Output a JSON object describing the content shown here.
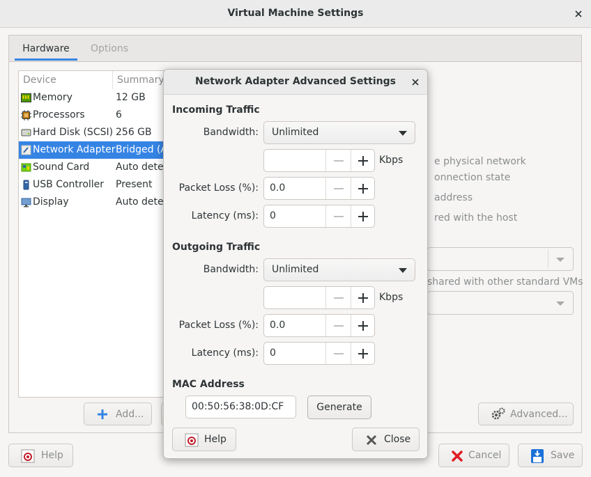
{
  "main": {
    "title": "Virtual Machine Settings",
    "tabs": [
      {
        "label": "Hardware",
        "active": true
      },
      {
        "label": "Options",
        "active": false
      }
    ],
    "list_headers": {
      "device": "Device",
      "summary": "Summary"
    },
    "devices": [
      {
        "name": "Memory",
        "summary": "12 GB",
        "icon": "memory-icon"
      },
      {
        "name": "Processors",
        "summary": "6",
        "icon": "processor-icon"
      },
      {
        "name": "Hard Disk (SCSI)",
        "summary": "256 GB",
        "icon": "hard-disk-icon"
      },
      {
        "name": "Network Adapter",
        "summary": "Bridged (Au",
        "icon": "network-adapter-icon",
        "selected": true
      },
      {
        "name": "Sound Card",
        "summary": "Auto detec",
        "icon": "sound-card-icon"
      },
      {
        "name": "USB Controller",
        "summary": "Present",
        "icon": "usb-icon"
      },
      {
        "name": "Display",
        "summary": "Auto detec",
        "icon": "display-icon"
      }
    ],
    "behind_text": {
      "line1": "e physical network",
      "line2": "onnection state",
      "line3": "address",
      "line4": "red with the host",
      "line5": "shared with other standard VMs"
    },
    "add_button": "Add...",
    "advanced_button": "Advanced...",
    "help_button": "Help",
    "cancel_button": "Cancel",
    "save_button": "Save"
  },
  "dialog": {
    "title": "Network Adapter Advanced Settings",
    "incoming": {
      "title": "Incoming Traffic",
      "bandwidth_label": "Bandwidth:",
      "bandwidth_value": "Unlimited",
      "kbps_value": "",
      "kbps_unit": "Kbps",
      "packet_loss_label": "Packet Loss (%):",
      "packet_loss_value": "0.0",
      "latency_label": "Latency (ms):",
      "latency_value": "0"
    },
    "outgoing": {
      "title": "Outgoing Traffic",
      "bandwidth_label": "Bandwidth:",
      "bandwidth_value": "Unlimited",
      "kbps_value": "",
      "kbps_unit": "Kbps",
      "packet_loss_label": "Packet Loss (%):",
      "packet_loss_value": "0.0",
      "latency_label": "Latency (ms):",
      "latency_value": "0"
    },
    "mac": {
      "title": "MAC Address",
      "value": "00:50:56:38:0D:CF",
      "generate_button": "Generate"
    },
    "help_button": "Help",
    "close_button": "Close"
  },
  "colors": {
    "accent": "#3584e4",
    "selected_text": "#ffffff",
    "dim_text": "#8b8e8f"
  }
}
